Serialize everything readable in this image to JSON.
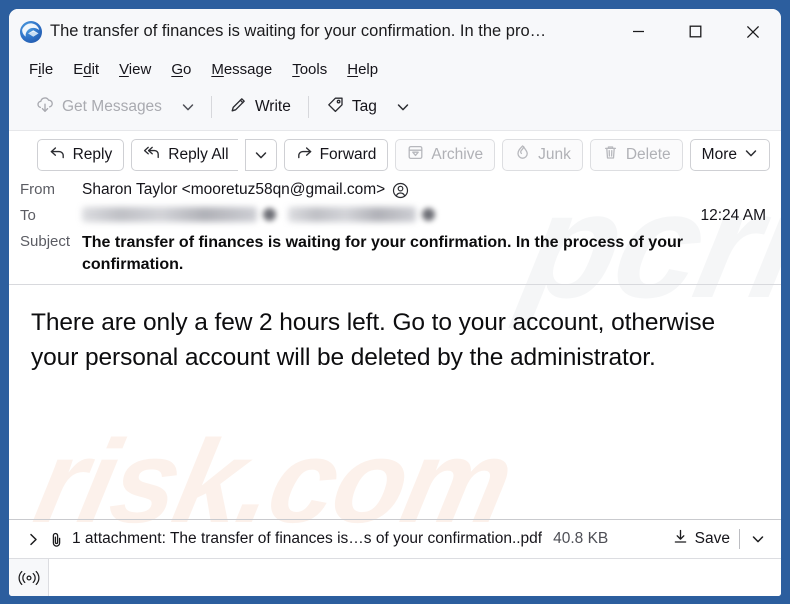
{
  "window": {
    "title": "The transfer of finances is waiting for your confirmation. In the pro…",
    "app_icon": "thunderbird-logo-icon",
    "border_color": "#2c5e9e",
    "controls": {
      "minimize": "minimize-icon",
      "maximize": "maximize-icon",
      "close": "close-icon"
    }
  },
  "menubar": {
    "items": [
      {
        "label": "File",
        "access_key": "i"
      },
      {
        "label": "Edit",
        "access_key": "d"
      },
      {
        "label": "View",
        "access_key": "V"
      },
      {
        "label": "Go",
        "access_key": "G"
      },
      {
        "label": "Message",
        "access_key": "M"
      },
      {
        "label": "Tools",
        "access_key": "T"
      },
      {
        "label": "Help",
        "access_key": "H"
      }
    ]
  },
  "toolbar": {
    "get_messages_label": "Get Messages",
    "get_messages_enabled": false,
    "write_label": "Write",
    "tag_label": "Tag"
  },
  "message_actions": {
    "reply_label": "Reply",
    "reply_all_label": "Reply All",
    "forward_label": "Forward",
    "archive_label": "Archive",
    "archive_enabled": false,
    "junk_label": "Junk",
    "junk_enabled": false,
    "delete_label": "Delete",
    "delete_enabled": false,
    "more_label": "More"
  },
  "headers": {
    "from_label": "From",
    "from_value": "Sharon Taylor <mooretuz58qn@gmail.com>",
    "to_label": "To",
    "to_value_redacted": true,
    "time": "12:24 AM",
    "subject_label": "Subject",
    "subject_value": "The transfer of finances is waiting for your confirmation. In the process of your confirmation."
  },
  "body": {
    "text": "There are only a few 2 hours left. Go to your account, otherwise your personal account will be deleted by the administrator."
  },
  "attachment": {
    "summary": "1 attachment: The transfer of finances is…s of your confirmation..pdf",
    "size": "40.8 KB",
    "save_label": "Save"
  },
  "statusbar": {
    "indicator_icon": "broadcast-signal-icon"
  },
  "watermark": {
    "top_text": "pcrisk.com",
    "bottom_text": "risk.com"
  }
}
